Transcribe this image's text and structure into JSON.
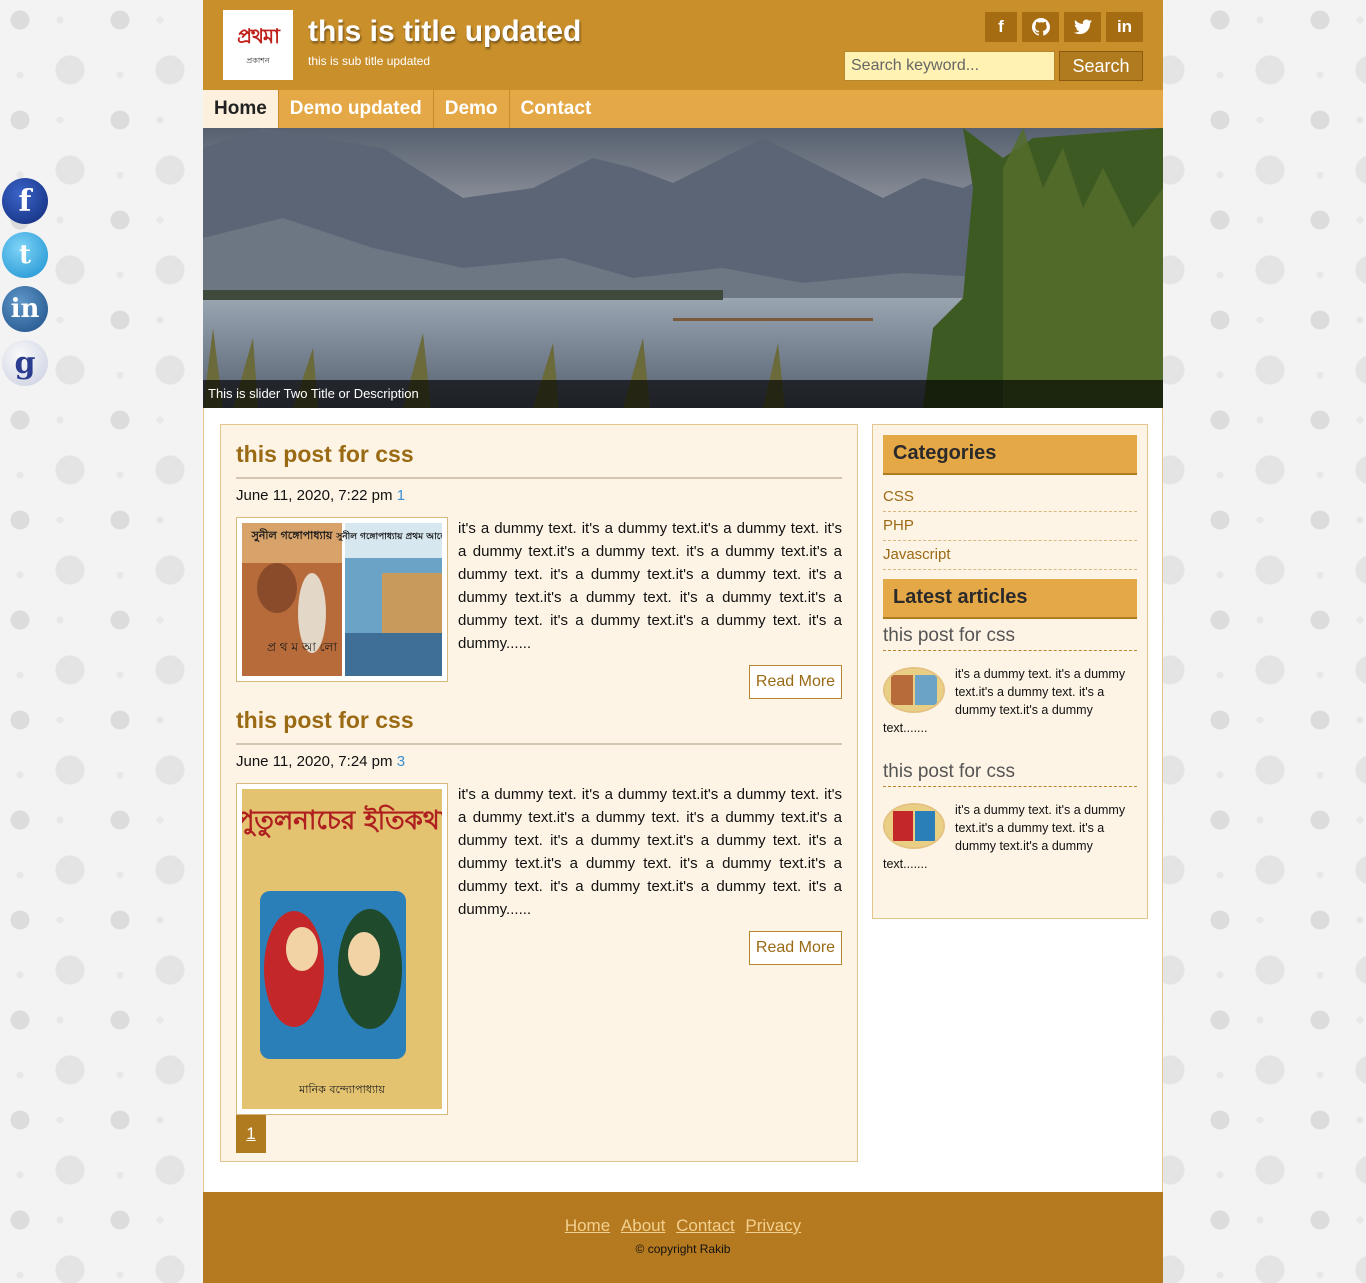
{
  "social_float": [
    {
      "name": "facebook",
      "glyph": "f"
    },
    {
      "name": "twitter",
      "glyph": "t"
    },
    {
      "name": "linkedin",
      "glyph": "in"
    },
    {
      "name": "google",
      "glyph": "g"
    }
  ],
  "header": {
    "logo_text": "প্রথমা",
    "logo_sub": "প্রকাশন",
    "title": "this is title updated",
    "subtitle": "this is sub title updated",
    "icons": [
      {
        "name": "facebook-icon",
        "glyph": "f"
      },
      {
        "name": "github-icon",
        "glyph": "◉"
      },
      {
        "name": "twitter-icon",
        "glyph": "🐦"
      },
      {
        "name": "linkedin-icon",
        "glyph": "in"
      }
    ],
    "search": {
      "placeholder": "Search keyword...",
      "value": "",
      "button": "Search"
    }
  },
  "nav": {
    "items": [
      {
        "label": "Home",
        "active": true
      },
      {
        "label": "Demo updated",
        "active": false
      },
      {
        "label": "Demo",
        "active": false
      },
      {
        "label": "Contact",
        "active": false
      }
    ]
  },
  "slider": {
    "caption": "This is slider Two Title or Description"
  },
  "posts": [
    {
      "title": "this post for css",
      "date": "June 11, 2020, 7:22 pm",
      "comment_count": "1",
      "excerpt": "it's a dummy text. it's a dummy text.it's a dummy text. it's a dummy text.it's a dummy text. it's a dummy text.it's a dummy text. it's a dummy text.it's a dummy text. it's a dummy text.it's a dummy text. it's a dummy text.it's a dummy text. it's a dummy text.it's a dummy text. it's a dummy......",
      "read_more": "Read More",
      "thumb_text_left": "সুনীল গঙ্গোপাধ্যায়",
      "thumb_text_right": "সুনীল গঙ্গোপাধ্যায় প্রথম আলো",
      "thumb_text_bottom": "প্র থ ম আ লো"
    },
    {
      "title": "this post for css",
      "date": "June 11, 2020, 7:24 pm",
      "comment_count": "3",
      "excerpt": "it's a dummy text. it's a dummy text.it's a dummy text. it's a dummy text.it's a dummy text. it's a dummy text.it's a dummy text. it's a dummy text.it's a dummy text. it's a dummy text.it's a dummy text. it's a dummy text.it's a dummy text. it's a dummy text.it's a dummy text. it's a dummy......",
      "read_more": "Read More",
      "thumb_title": "পুতুলনাচের ইতিকথা",
      "thumb_author": "মানিক বন্দ্যোপাধ্যায়"
    }
  ],
  "pagination": {
    "current": "1"
  },
  "sidebar": {
    "categories_title": "Categories",
    "categories": [
      "CSS",
      "PHP",
      "Javascript"
    ],
    "latest_title": "Latest articles",
    "latest": [
      {
        "title": "this post for css",
        "text": "it's a dummy text. it's a dummy text.it's a dummy text. it's a dummy text.it's a dummy text......."
      },
      {
        "title": "this post for css",
        "text": "it's a dummy text. it's a dummy text.it's a dummy text. it's a dummy text.it's a dummy text......."
      }
    ]
  },
  "footer": {
    "links": [
      "Home",
      "About",
      "Contact",
      "Privacy"
    ],
    "copyright": "© copyright Rakib"
  },
  "colors": {
    "header_bg": "#c98f2a",
    "nav_bg": "#e5a846",
    "accent_text": "#9a6a14",
    "footer_bg": "#b57a1f",
    "content_bg": "#fdf4e6"
  }
}
